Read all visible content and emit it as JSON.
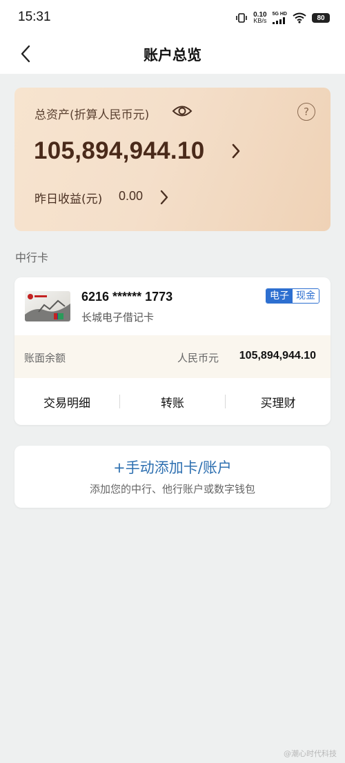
{
  "status": {
    "time": "15:31",
    "net_speed_value": "0.10",
    "net_speed_unit": "KB/s",
    "net_type": "5G HD",
    "battery": "80"
  },
  "header": {
    "title": "账户总览"
  },
  "assets": {
    "label": "总资产(折算人民币元)",
    "amount": "105,894,944.10",
    "yesterday_label": "昨日收益(元)",
    "yesterday_value": "0.00",
    "help_symbol": "?"
  },
  "section": {
    "title": "中行卡"
  },
  "card": {
    "number": "6216 ****** 1773",
    "name": "长城电子借记卡",
    "badge_left": "电子",
    "badge_right": "现金",
    "balance_label": "账面余额",
    "balance_currency": "人民币元",
    "balance_value": "105,894,944.10",
    "actions": [
      "交易明细",
      "转账",
      "买理财"
    ]
  },
  "add_account": {
    "title": "+手动添加卡/账户",
    "subtitle": "添加您的中行、他行账户或数字钱包"
  },
  "watermark": "@潮心时代科技",
  "colors": {
    "accent_blue": "#2d6fd0",
    "asset_card_gradient_start": "#f7e4cf",
    "asset_card_gradient_end": "#efd2b6",
    "amount_text": "#4a2a1a"
  }
}
